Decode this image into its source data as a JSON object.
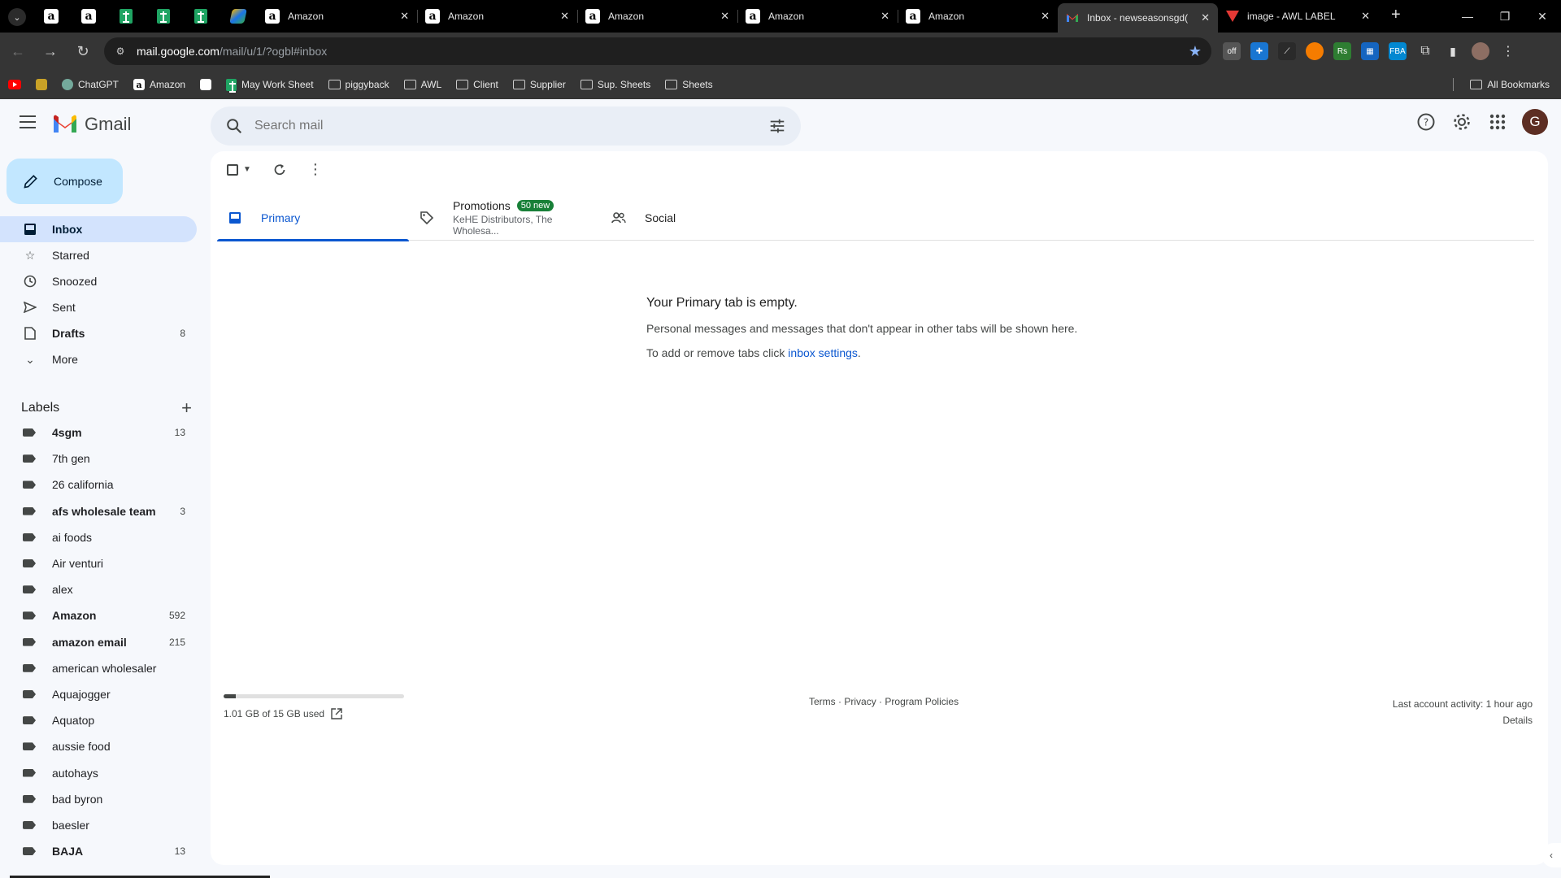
{
  "browser": {
    "tabs": [
      {
        "title": "Amazon"
      },
      {
        "title": "Amazon"
      },
      {
        "title": "Amazon"
      },
      {
        "title": "Amazon"
      },
      {
        "title": "Amazon"
      },
      {
        "title": "Inbox - newseasonsgd("
      },
      {
        "title": "image - AWL LABEL"
      }
    ],
    "url_host": "mail.google.com",
    "url_path": "/mail/u/1/?ogbl#inbox",
    "bookmarks": [
      {
        "label": "ChatGPT"
      },
      {
        "label": "Amazon"
      },
      {
        "label": "May Work Sheet"
      },
      {
        "label": "piggyback"
      },
      {
        "label": "AWL"
      },
      {
        "label": "Client"
      },
      {
        "label": "Supplier"
      },
      {
        "label": "Sup. Sheets"
      },
      {
        "label": "Sheets"
      }
    ],
    "all_bookmarks": "All Bookmarks"
  },
  "gmail": {
    "brand": "Gmail",
    "search_placeholder": "Search mail",
    "avatar_letter": "G",
    "compose": "Compose",
    "nav": [
      {
        "label": "Inbox",
        "count": ""
      },
      {
        "label": "Starred",
        "count": ""
      },
      {
        "label": "Snoozed",
        "count": ""
      },
      {
        "label": "Sent",
        "count": ""
      },
      {
        "label": "Drafts",
        "count": "8"
      },
      {
        "label": "More",
        "count": ""
      }
    ],
    "labels_heading": "Labels",
    "labels": [
      {
        "label": "4sgm",
        "count": "13"
      },
      {
        "label": "7th gen",
        "count": ""
      },
      {
        "label": "26 california",
        "count": ""
      },
      {
        "label": "afs wholesale team",
        "count": "3"
      },
      {
        "label": "ai foods",
        "count": ""
      },
      {
        "label": "Air venturi",
        "count": ""
      },
      {
        "label": "alex",
        "count": ""
      },
      {
        "label": "Amazon",
        "count": "592"
      },
      {
        "label": "amazon email",
        "count": "215"
      },
      {
        "label": "american wholesaler",
        "count": ""
      },
      {
        "label": "Aquajogger",
        "count": ""
      },
      {
        "label": "Aquatop",
        "count": ""
      },
      {
        "label": "aussie food",
        "count": ""
      },
      {
        "label": "autohays",
        "count": ""
      },
      {
        "label": "bad byron",
        "count": ""
      },
      {
        "label": "baesler",
        "count": ""
      },
      {
        "label": "BAJA",
        "count": "13"
      }
    ],
    "tabs": {
      "primary": "Primary",
      "promotions": "Promotions",
      "promotions_badge": "50 new",
      "promotions_sub": "KeHE Distributors, The Wholesa...",
      "social": "Social"
    },
    "empty": {
      "heading": "Your Primary tab is empty.",
      "line1": "Personal messages and messages that don't appear in other tabs will be shown here.",
      "line2_prefix": "To add or remove tabs click ",
      "line2_link": "inbox settings",
      "line2_suffix": "."
    },
    "footer": {
      "storage": "1.01 GB of 15 GB used",
      "storage_fraction": 0.067,
      "terms": "Terms",
      "privacy": "Privacy",
      "policies": "Program Policies",
      "sep": "·",
      "last_activity": "Last account activity: 1 hour ago",
      "details": "Details"
    }
  }
}
